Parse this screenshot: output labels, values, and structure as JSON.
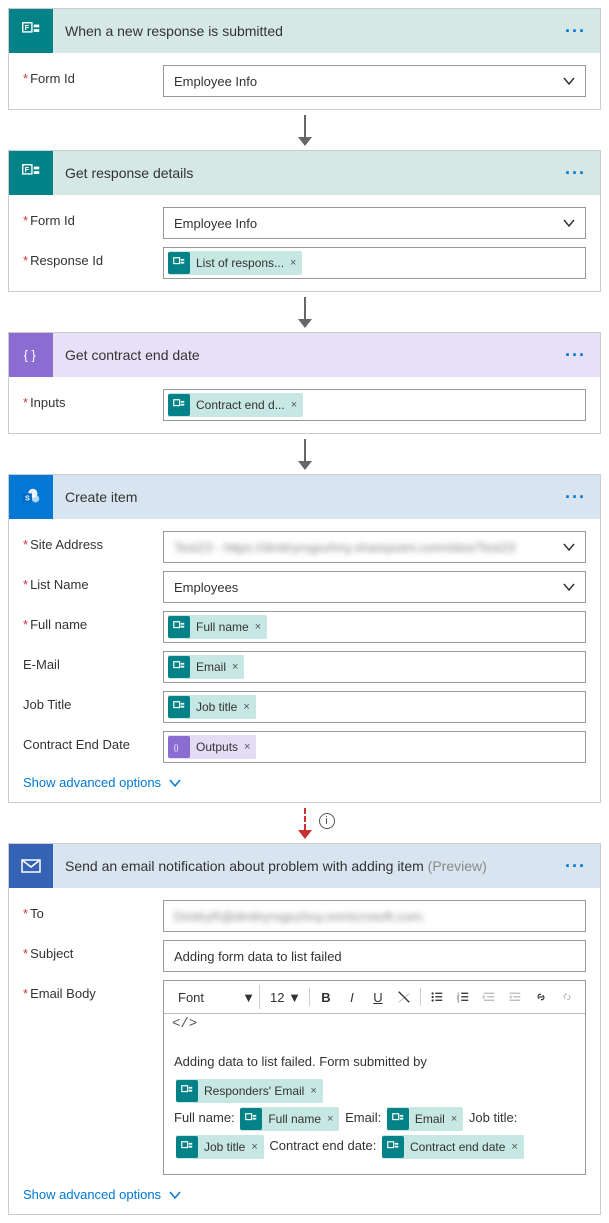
{
  "cards": {
    "trigger": {
      "title": "When a new response is submitted",
      "formId": {
        "label": "Form Id",
        "value": "Employee Info"
      }
    },
    "getResponse": {
      "title": "Get response details",
      "formId": {
        "label": "Form Id",
        "value": "Employee Info"
      },
      "responseId": {
        "label": "Response Id",
        "token": "List of respons..."
      }
    },
    "compose": {
      "title": "Get contract end date",
      "inputs": {
        "label": "Inputs",
        "token": "Contract end d..."
      }
    },
    "createItem": {
      "title": "Create item",
      "siteAddress": {
        "label": "Site Address",
        "value": "Test23 - https://dmitryrogozhny.sharepoint.com/sites/Test23"
      },
      "listName": {
        "label": "List Name",
        "value": "Employees"
      },
      "fullName": {
        "label": "Full name",
        "token": "Full name"
      },
      "email": {
        "label": "E-Mail",
        "token": "Email"
      },
      "jobTitle": {
        "label": "Job Title",
        "token": "Job title"
      },
      "contractEnd": {
        "label": "Contract End Date",
        "token": "Outputs"
      },
      "advanced": "Show advanced options"
    },
    "sendEmail": {
      "title": "Send an email notification about problem with adding item",
      "preview": "(Preview)",
      "to": {
        "label": "To",
        "value": "DmitryR@dmitryrogozhny.onmicrosoft.com;"
      },
      "subject": {
        "label": "Subject",
        "value": "Adding form data to list failed"
      },
      "body": {
        "label": "Email Body",
        "font": "Font",
        "size": "12",
        "text1": "Adding data to list failed. Form submitted by",
        "tok_resp": "Responders' Email",
        "lbl_fullname": "Full name:",
        "tok_fullname": "Full name",
        "lbl_email": "Email:",
        "tok_email": "Email",
        "lbl_jobtitle": "Job title:",
        "tok_jobtitle": "Job title",
        "lbl_contract": "Contract end date:",
        "tok_contract": "Contract end date"
      },
      "advanced": "Show advanced options"
    }
  }
}
